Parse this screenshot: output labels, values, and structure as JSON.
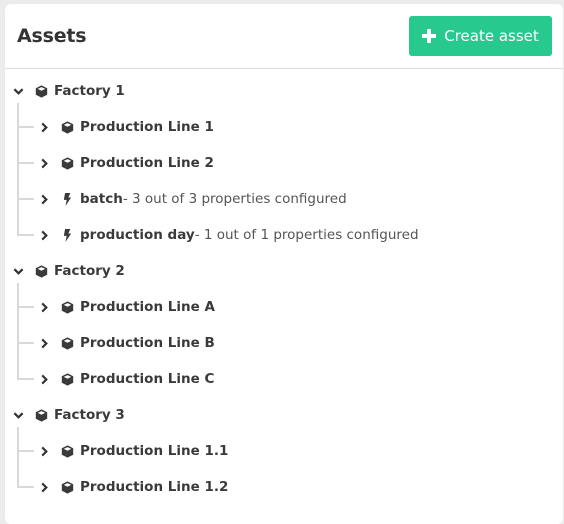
{
  "header": {
    "title": "Assets",
    "create_button": {
      "label": "Create asset",
      "icon": "plus-icon"
    }
  },
  "colors": {
    "accent": "#28c98e",
    "guide": "#d9d9d9",
    "background": "#ececec"
  },
  "tree": [
    {
      "name": "Factory 1",
      "type": "asset",
      "icon": "cube-icon",
      "expanded": true,
      "children": [
        {
          "name": "Production Line 1",
          "type": "asset",
          "icon": "cube-icon",
          "expanded": false
        },
        {
          "name": "Production Line 2",
          "type": "asset",
          "icon": "cube-icon",
          "expanded": false
        },
        {
          "name": "batch",
          "type": "event",
          "icon": "bolt-icon",
          "expanded": false,
          "desc": " - 3 out of 3 properties configured"
        },
        {
          "name": "production day",
          "type": "event",
          "icon": "bolt-icon",
          "expanded": false,
          "desc": " - 1 out of 1 properties configured"
        }
      ]
    },
    {
      "name": "Factory 2",
      "type": "asset",
      "icon": "cube-icon",
      "expanded": true,
      "children": [
        {
          "name": "Production Line A",
          "type": "asset",
          "icon": "cube-icon",
          "expanded": false
        },
        {
          "name": "Production Line B",
          "type": "asset",
          "icon": "cube-icon",
          "expanded": false
        },
        {
          "name": "Production Line C",
          "type": "asset",
          "icon": "cube-icon",
          "expanded": false
        }
      ]
    },
    {
      "name": "Factory 3",
      "type": "asset",
      "icon": "cube-icon",
      "expanded": true,
      "children": [
        {
          "name": "Production Line 1.1",
          "type": "asset",
          "icon": "cube-icon",
          "expanded": false
        },
        {
          "name": "Production Line 1.2",
          "type": "asset",
          "icon": "cube-icon",
          "expanded": false
        }
      ]
    }
  ]
}
